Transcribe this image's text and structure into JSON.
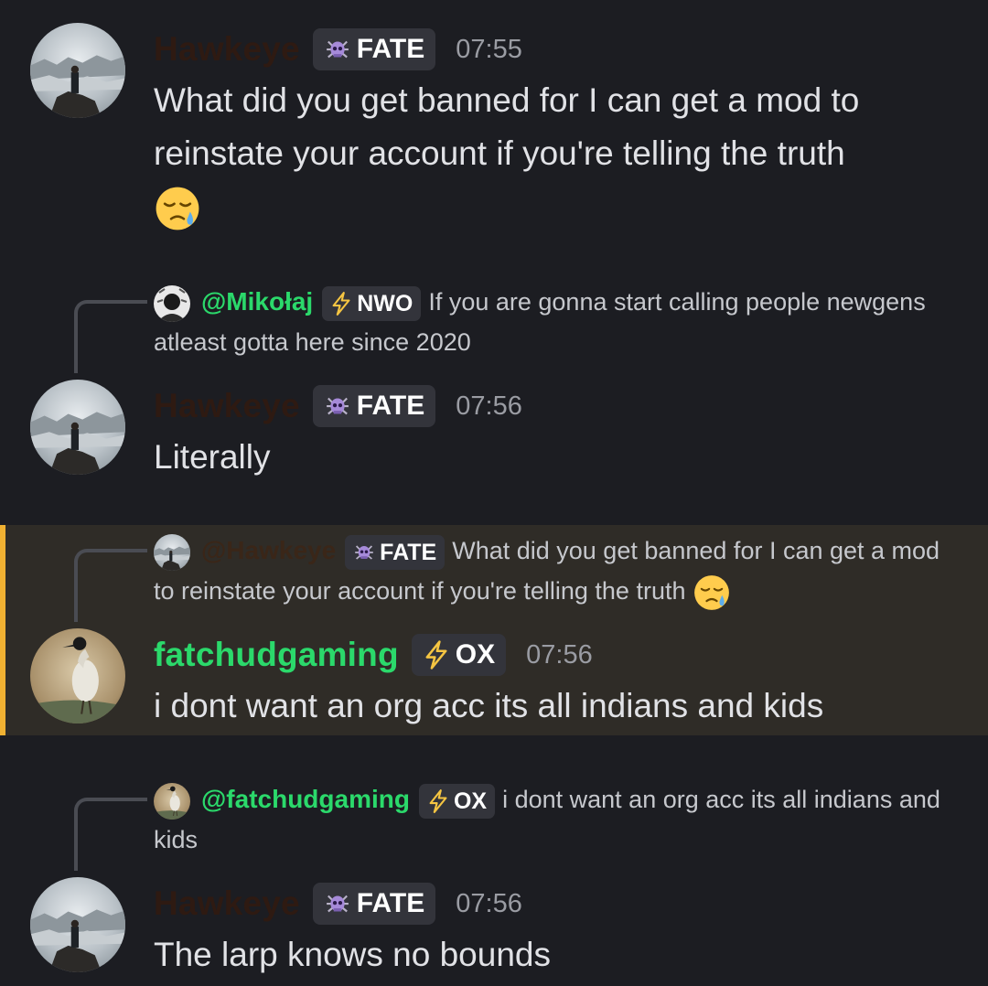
{
  "colors": {
    "background": "#1c1d22",
    "highlight_bg": "#2f2c27",
    "highlight_bar": "#f0b132",
    "green_name": "#2bd96b",
    "tag_bg": "#33343b"
  },
  "messages": [
    {
      "author": "Hawkeye",
      "tag": "FATE",
      "tag_icon": "skull-spider-icon",
      "time": "07:55",
      "text": "What did you get banned for I can get a mod to reinstate your account if you're telling the truth",
      "emoji": "sad-relieved-face-emoji"
    },
    {
      "reply_to": {
        "mention": "@Mikołaj",
        "tag": "NWO",
        "tag_icon": "lightning-icon",
        "text": "If you are gonna start calling people newgens atleast gotta here since 2020"
      },
      "author": "Hawkeye",
      "tag": "FATE",
      "time": "07:56",
      "text": "Literally"
    },
    {
      "reply_to": {
        "mention": "@Hawkeye",
        "tag": "FATE",
        "text": "What did you get banned for I can get a mod to reinstate your account if you're telling the truth"
      },
      "author": "fatchudgaming",
      "tag": "OX",
      "tag_icon": "lightning-icon",
      "time": "07:56",
      "text": "i dont want an org acc its all indians and kids",
      "highlighted": true
    },
    {
      "reply_to": {
        "mention": "@fatchudgaming",
        "tag": "OX",
        "text": "i dont want an org acc its all indians and kids"
      },
      "author": "Hawkeye",
      "tag": "FATE",
      "time": "07:56",
      "text": "The larp knows no bounds"
    }
  ]
}
